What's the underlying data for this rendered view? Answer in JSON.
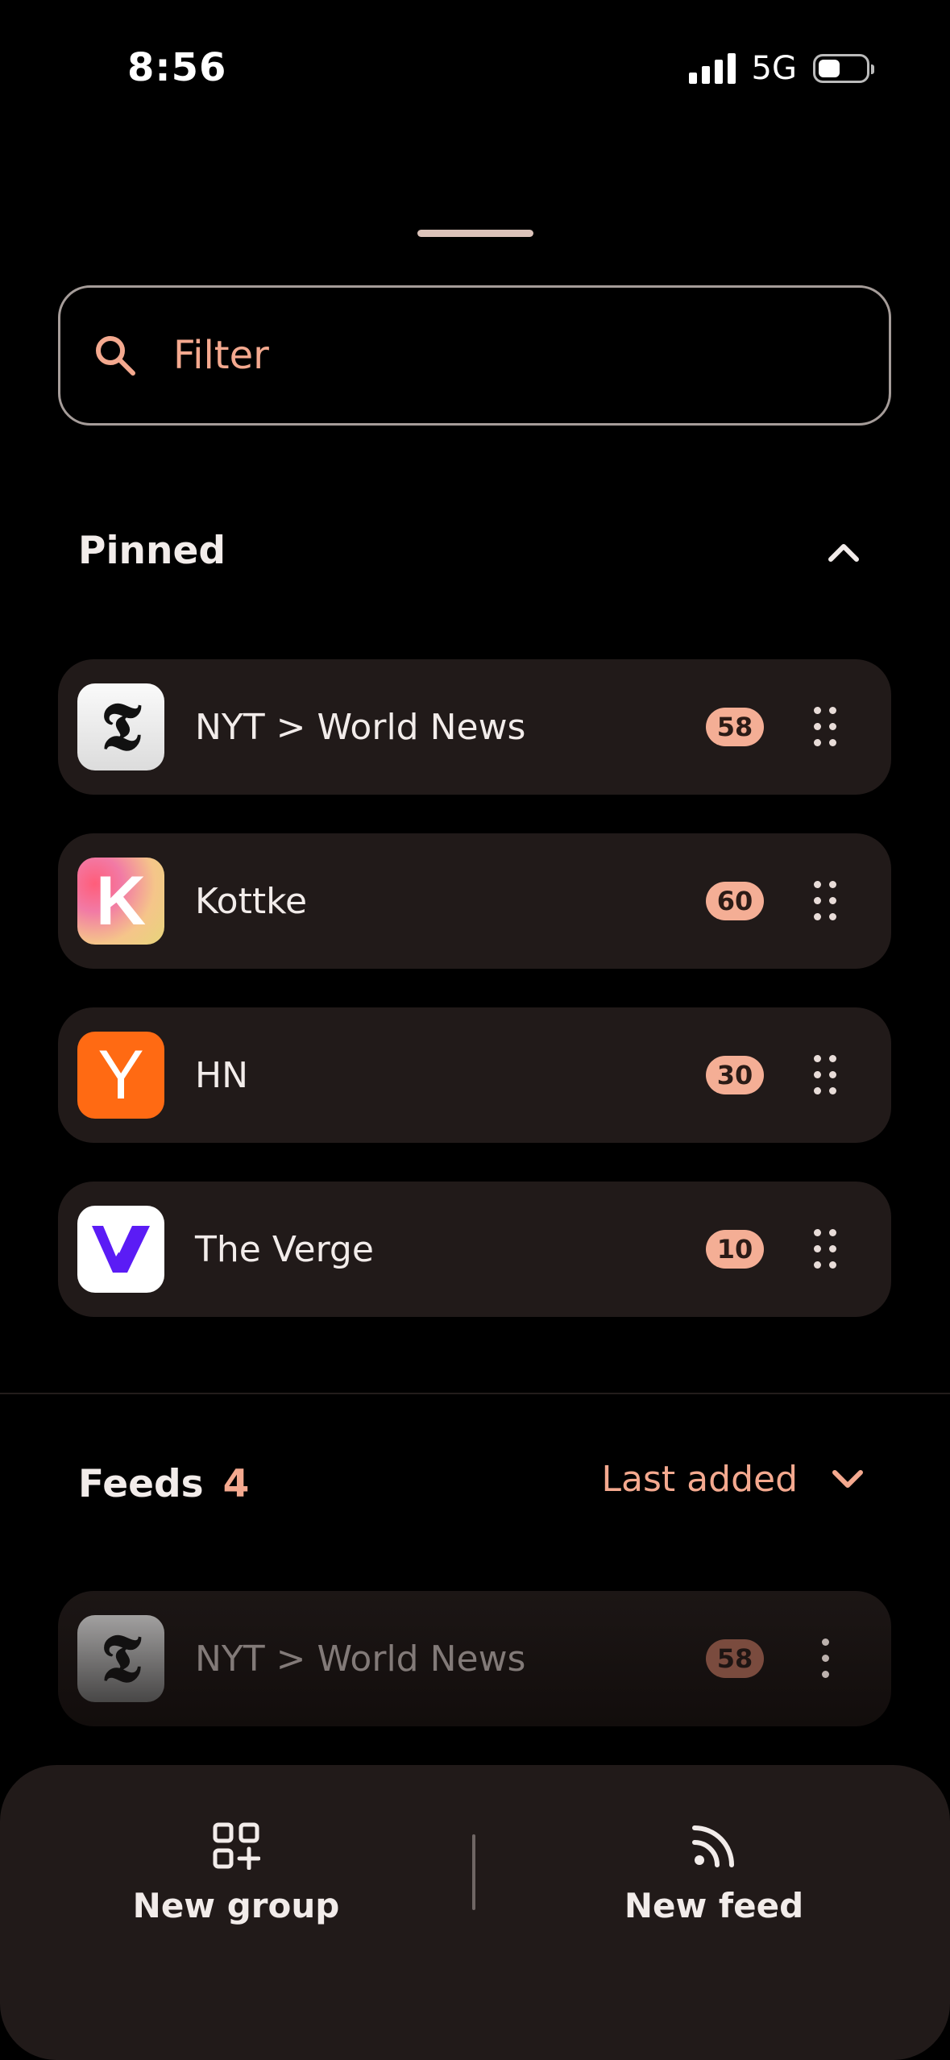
{
  "status_bar": {
    "time": "8:56",
    "network": "5G"
  },
  "filter": {
    "placeholder": "Filter"
  },
  "pinned": {
    "title": "Pinned",
    "items": [
      {
        "title": "NYT > World News",
        "count": "58",
        "icon": "nyt-logo-icon"
      },
      {
        "title": "Kottke",
        "count": "60",
        "icon": "kottke-logo-icon"
      },
      {
        "title": "HN",
        "count": "30",
        "icon": "hn-logo-icon"
      },
      {
        "title": "The Verge",
        "count": "10",
        "icon": "verge-logo-icon"
      }
    ]
  },
  "feeds": {
    "title": "Feeds",
    "count": "4",
    "sort_label": "Last added",
    "items": [
      {
        "title": "NYT > World News",
        "count": "58",
        "icon": "nyt-logo-icon"
      }
    ]
  },
  "logos": {
    "nyt": "𝕿",
    "kottke": "K",
    "hn": "Y"
  },
  "bottom_bar": {
    "new_group": "New group",
    "new_feed": "New feed"
  },
  "colors": {
    "accent": "#f4a98f",
    "badge": "#f4ae95",
    "card": "#211a19",
    "background": "#000000",
    "hn": "#ff6a13",
    "verge": "#5b1cf5"
  }
}
